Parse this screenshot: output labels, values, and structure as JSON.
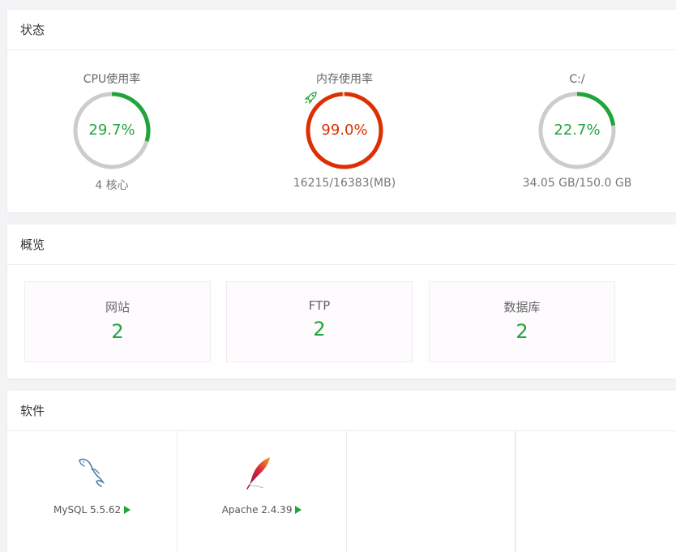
{
  "status": {
    "title": "状态",
    "gauges": [
      {
        "title": "CPU使用率",
        "value_text": "29.7%",
        "percent": 29.7,
        "foot": "4 核心",
        "color": "#20a53a"
      },
      {
        "title": "内存使用率",
        "value_text": "99.0%",
        "percent": 99.0,
        "foot": "16215/16383(MB)",
        "color": "#dd2f00",
        "icon": "rocket-icon"
      },
      {
        "title": "C:/",
        "value_text": "22.7%",
        "percent": 22.7,
        "foot": "34.05 GB/150.0 GB",
        "color": "#20a53a"
      }
    ],
    "track_color": "#cccccc"
  },
  "overview": {
    "title": "概览",
    "cards": [
      {
        "label": "网站",
        "value": "2"
      },
      {
        "label": "FTP",
        "value": "2"
      },
      {
        "label": "数据库",
        "value": "2"
      }
    ]
  },
  "software": {
    "title": "软件",
    "items": [
      {
        "label": "MySQL 5.5.62",
        "icon": "mysql-dolphin-icon"
      },
      {
        "label": "Apache 2.4.39",
        "icon": "apache-feather-icon"
      }
    ]
  }
}
